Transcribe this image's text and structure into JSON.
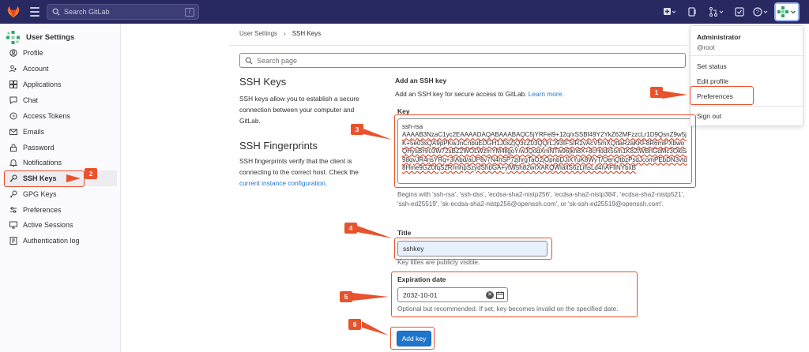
{
  "topbar": {
    "search_placeholder": "Search GitLab",
    "search_shortcut": "/",
    "brand_color": "#292961"
  },
  "sidebar": {
    "title": "User Settings",
    "items": [
      {
        "label": "Profile",
        "icon": "profile-icon"
      },
      {
        "label": "Account",
        "icon": "account-icon"
      },
      {
        "label": "Applications",
        "icon": "applications-icon"
      },
      {
        "label": "Chat",
        "icon": "chat-icon"
      },
      {
        "label": "Access Tokens",
        "icon": "token-icon"
      },
      {
        "label": "Emails",
        "icon": "mail-icon"
      },
      {
        "label": "Password",
        "icon": "lock-icon"
      },
      {
        "label": "Notifications",
        "icon": "bell-icon"
      },
      {
        "label": "SSH Keys",
        "icon": "key-icon",
        "active": true
      },
      {
        "label": "GPG Keys",
        "icon": "key-icon"
      },
      {
        "label": "Preferences",
        "icon": "preferences-icon"
      },
      {
        "label": "Active Sessions",
        "icon": "monitor-icon"
      },
      {
        "label": "Authentication log",
        "icon": "log-icon"
      }
    ]
  },
  "breadcrumb": {
    "parent": "User Settings",
    "sep": "›",
    "current": "SSH Keys"
  },
  "page_search": {
    "placeholder": "Search page"
  },
  "ssh_section": {
    "heading": "SSH Keys",
    "description": "SSH keys allow you to establish a secure connection between your computer and GitLab."
  },
  "fingerprint_section": {
    "heading": "SSH Fingerprints",
    "description": "SSH fingerprints verify that the client is connecting to the correct host. Check the",
    "link": "current instance configuration",
    "link_suffix": "."
  },
  "form": {
    "title": "Add an SSH key",
    "description": "Add an SSH key for secure access to GitLab.",
    "learn_more": "Learn more.",
    "key_label": "Key",
    "key_first_line": "ssh-rsa",
    "key_value": "AAAAB3NzaC1yc2EAAAADAQABAAABAQC5jYRFel9+12q/xSSBf49Y2YkZ62MFzzcLr1D9QsnZ9w5jK+5e03sQA9pPKwJnCnbuEDGH1J0xZjQ3cZ03QQrLJ93IFSIR2vAcV5mXQttaRzaKKF8R6miPXbwoQHysBH/03W72sBZ2WOLWzmYM4llgoY/wJQodXmNTw96jkn8X+8cHodx55m1K82tWBhGdMc3OkiS98qvJR4nsYRq+3IAbd/aUP8v7N4hSP7zjhrgTaO2jOpnbDJiXYuK8WyT/OenQtbzPsdJcomPEbDN3vtd8Hme9GZ0fqS2RrmhpSzydShbGA+ytW5h82wrXAKQWIaIlS6zLihsLd4nAFIlNYbxB",
    "key_help": "Begins with 'ssh-rsa', 'ssh-dss', 'ecdsa-sha2-nistp256', 'ecdsa-sha2-nistp384', 'ecdsa-sha2-nistp521', 'ssh-ed25519', 'sk-ecdsa-sha2-nistp256@openssh.com', or 'sk-ssh-ed25519@openssh.com'.",
    "title_label": "Title",
    "title_value": "sshkey",
    "title_help": "Key titles are publicly visible.",
    "expiration_label": "Expiration date",
    "expiration_value": "2032-10-01",
    "expiration_help": "Optional but recommended. If set, key becomes invalid on the specified date.",
    "submit_label": "Add key"
  },
  "user_menu": {
    "name": "Administrator",
    "username": "@root",
    "items": [
      "Set status",
      "Edit profile",
      "Preferences",
      "Sign out"
    ]
  },
  "annotations": {
    "badges": [
      "1",
      "2",
      "3",
      "4",
      "5",
      "6"
    ],
    "color": "#e8522c"
  }
}
